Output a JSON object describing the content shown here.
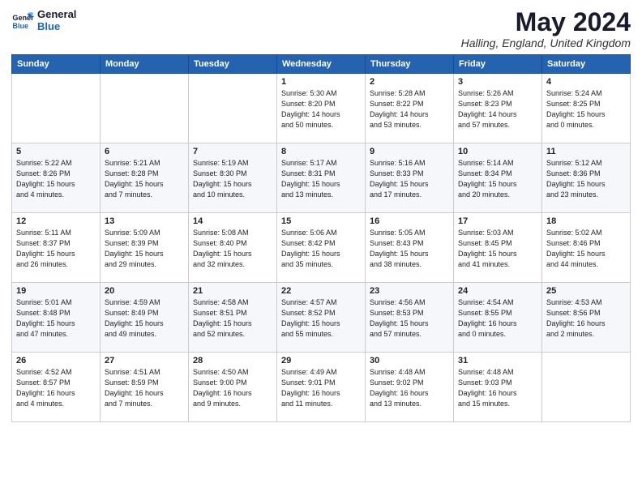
{
  "header": {
    "logo_line1": "General",
    "logo_line2": "Blue",
    "month_title": "May 2024",
    "location": "Halling, England, United Kingdom"
  },
  "weekdays": [
    "Sunday",
    "Monday",
    "Tuesday",
    "Wednesday",
    "Thursday",
    "Friday",
    "Saturday"
  ],
  "weeks": [
    [
      {
        "day": "",
        "info": ""
      },
      {
        "day": "",
        "info": ""
      },
      {
        "day": "",
        "info": ""
      },
      {
        "day": "1",
        "info": "Sunrise: 5:30 AM\nSunset: 8:20 PM\nDaylight: 14 hours\nand 50 minutes."
      },
      {
        "day": "2",
        "info": "Sunrise: 5:28 AM\nSunset: 8:22 PM\nDaylight: 14 hours\nand 53 minutes."
      },
      {
        "day": "3",
        "info": "Sunrise: 5:26 AM\nSunset: 8:23 PM\nDaylight: 14 hours\nand 57 minutes."
      },
      {
        "day": "4",
        "info": "Sunrise: 5:24 AM\nSunset: 8:25 PM\nDaylight: 15 hours\nand 0 minutes."
      }
    ],
    [
      {
        "day": "5",
        "info": "Sunrise: 5:22 AM\nSunset: 8:26 PM\nDaylight: 15 hours\nand 4 minutes."
      },
      {
        "day": "6",
        "info": "Sunrise: 5:21 AM\nSunset: 8:28 PM\nDaylight: 15 hours\nand 7 minutes."
      },
      {
        "day": "7",
        "info": "Sunrise: 5:19 AM\nSunset: 8:30 PM\nDaylight: 15 hours\nand 10 minutes."
      },
      {
        "day": "8",
        "info": "Sunrise: 5:17 AM\nSunset: 8:31 PM\nDaylight: 15 hours\nand 13 minutes."
      },
      {
        "day": "9",
        "info": "Sunrise: 5:16 AM\nSunset: 8:33 PM\nDaylight: 15 hours\nand 17 minutes."
      },
      {
        "day": "10",
        "info": "Sunrise: 5:14 AM\nSunset: 8:34 PM\nDaylight: 15 hours\nand 20 minutes."
      },
      {
        "day": "11",
        "info": "Sunrise: 5:12 AM\nSunset: 8:36 PM\nDaylight: 15 hours\nand 23 minutes."
      }
    ],
    [
      {
        "day": "12",
        "info": "Sunrise: 5:11 AM\nSunset: 8:37 PM\nDaylight: 15 hours\nand 26 minutes."
      },
      {
        "day": "13",
        "info": "Sunrise: 5:09 AM\nSunset: 8:39 PM\nDaylight: 15 hours\nand 29 minutes."
      },
      {
        "day": "14",
        "info": "Sunrise: 5:08 AM\nSunset: 8:40 PM\nDaylight: 15 hours\nand 32 minutes."
      },
      {
        "day": "15",
        "info": "Sunrise: 5:06 AM\nSunset: 8:42 PM\nDaylight: 15 hours\nand 35 minutes."
      },
      {
        "day": "16",
        "info": "Sunrise: 5:05 AM\nSunset: 8:43 PM\nDaylight: 15 hours\nand 38 minutes."
      },
      {
        "day": "17",
        "info": "Sunrise: 5:03 AM\nSunset: 8:45 PM\nDaylight: 15 hours\nand 41 minutes."
      },
      {
        "day": "18",
        "info": "Sunrise: 5:02 AM\nSunset: 8:46 PM\nDaylight: 15 hours\nand 44 minutes."
      }
    ],
    [
      {
        "day": "19",
        "info": "Sunrise: 5:01 AM\nSunset: 8:48 PM\nDaylight: 15 hours\nand 47 minutes."
      },
      {
        "day": "20",
        "info": "Sunrise: 4:59 AM\nSunset: 8:49 PM\nDaylight: 15 hours\nand 49 minutes."
      },
      {
        "day": "21",
        "info": "Sunrise: 4:58 AM\nSunset: 8:51 PM\nDaylight: 15 hours\nand 52 minutes."
      },
      {
        "day": "22",
        "info": "Sunrise: 4:57 AM\nSunset: 8:52 PM\nDaylight: 15 hours\nand 55 minutes."
      },
      {
        "day": "23",
        "info": "Sunrise: 4:56 AM\nSunset: 8:53 PM\nDaylight: 15 hours\nand 57 minutes."
      },
      {
        "day": "24",
        "info": "Sunrise: 4:54 AM\nSunset: 8:55 PM\nDaylight: 16 hours\nand 0 minutes."
      },
      {
        "day": "25",
        "info": "Sunrise: 4:53 AM\nSunset: 8:56 PM\nDaylight: 16 hours\nand 2 minutes."
      }
    ],
    [
      {
        "day": "26",
        "info": "Sunrise: 4:52 AM\nSunset: 8:57 PM\nDaylight: 16 hours\nand 4 minutes."
      },
      {
        "day": "27",
        "info": "Sunrise: 4:51 AM\nSunset: 8:59 PM\nDaylight: 16 hours\nand 7 minutes."
      },
      {
        "day": "28",
        "info": "Sunrise: 4:50 AM\nSunset: 9:00 PM\nDaylight: 16 hours\nand 9 minutes."
      },
      {
        "day": "29",
        "info": "Sunrise: 4:49 AM\nSunset: 9:01 PM\nDaylight: 16 hours\nand 11 minutes."
      },
      {
        "day": "30",
        "info": "Sunrise: 4:48 AM\nSunset: 9:02 PM\nDaylight: 16 hours\nand 13 minutes."
      },
      {
        "day": "31",
        "info": "Sunrise: 4:48 AM\nSunset: 9:03 PM\nDaylight: 16 hours\nand 15 minutes."
      },
      {
        "day": "",
        "info": ""
      }
    ]
  ]
}
